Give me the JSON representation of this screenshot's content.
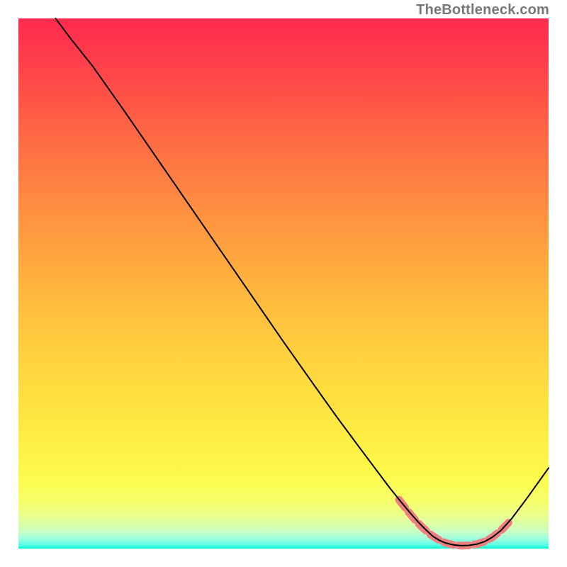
{
  "attribution": "TheBottleneck.com",
  "chart_data": {
    "type": "line",
    "title": "",
    "xlabel": "",
    "ylabel": "",
    "xlim": [
      0,
      100
    ],
    "ylim": [
      0,
      100
    ],
    "grid": false,
    "curve": {
      "color": "#000000",
      "width": 2,
      "points_xy": [
        [
          7,
          100
        ],
        [
          10,
          96
        ],
        [
          14,
          91
        ],
        [
          20,
          82.5
        ],
        [
          30,
          68
        ],
        [
          40,
          53.5
        ],
        [
          50,
          39
        ],
        [
          56,
          30.5
        ],
        [
          60,
          24.9
        ],
        [
          64,
          19.5
        ],
        [
          67,
          15.5
        ],
        [
          70,
          11.5
        ],
        [
          72,
          9.0
        ],
        [
          74,
          6.6
        ],
        [
          75.6,
          4.8
        ],
        [
          77,
          3.4
        ],
        [
          78.2,
          2.3
        ],
        [
          79.4,
          1.55
        ],
        [
          80.6,
          1.05
        ],
        [
          82,
          0.7
        ],
        [
          83.5,
          0.55
        ],
        [
          85,
          0.6
        ],
        [
          86.5,
          0.85
        ],
        [
          88,
          1.35
        ],
        [
          89.4,
          2.15
        ],
        [
          91,
          3.4
        ],
        [
          93,
          5.6
        ],
        [
          96,
          9.6
        ],
        [
          100,
          15.2
        ]
      ]
    },
    "highlight_band": {
      "color": "#f08080",
      "width": 11,
      "points_xy": [
        [
          71.8,
          9.2
        ],
        [
          73.5,
          7.0
        ],
        [
          75.0,
          5.2
        ],
        [
          76.4,
          3.8
        ],
        [
          77.8,
          2.6
        ],
        [
          79.2,
          1.7
        ],
        [
          80.6,
          1.05
        ],
        [
          82.0,
          0.7
        ],
        [
          83.5,
          0.55
        ],
        [
          85.0,
          0.6
        ],
        [
          86.5,
          0.85
        ],
        [
          88.0,
          1.35
        ],
        [
          89.4,
          2.15
        ],
        [
          91.0,
          3.4
        ],
        [
          92.5,
          4.95
        ]
      ]
    }
  }
}
